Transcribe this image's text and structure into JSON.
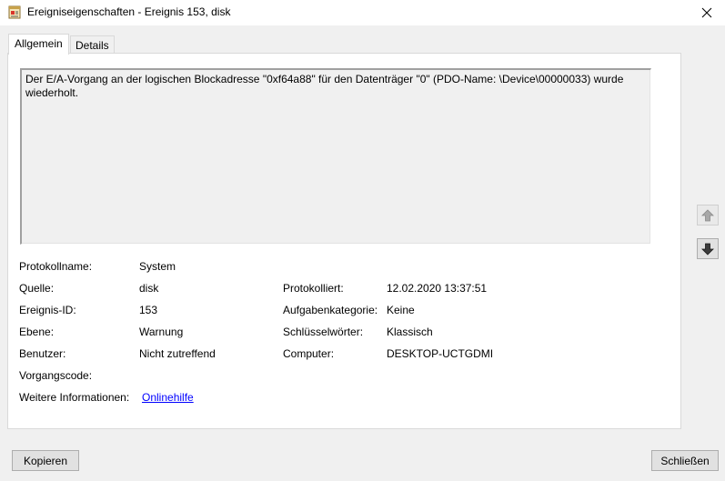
{
  "window": {
    "title": "Ereigniseigenschaften - Ereignis 153, disk"
  },
  "tabs": [
    {
      "label": "Allgemein",
      "active": true
    },
    {
      "label": "Details",
      "active": false
    }
  ],
  "general": {
    "description": "Der E/A-Vorgang an der logischen Blockadresse \"0xf64a88\" für den Datenträger \"0\" (PDO-Name: \\Device\\00000033) wurde wiederholt.",
    "fields": {
      "log_name": {
        "label": "Protokollname:",
        "value": "System"
      },
      "source": {
        "label": "Quelle:",
        "value": "disk"
      },
      "logged": {
        "label": "Protokolliert:",
        "value": "12.02.2020 13:37:51"
      },
      "event_id": {
        "label": "Ereignis-ID:",
        "value": "153"
      },
      "task_category": {
        "label": "Aufgabenkategorie:",
        "value": "Keine"
      },
      "level": {
        "label": "Ebene:",
        "value": "Warnung"
      },
      "keywords": {
        "label": "Schlüsselwörter:",
        "value": "Klassisch"
      },
      "user": {
        "label": "Benutzer:",
        "value": "Nicht zutreffend"
      },
      "computer": {
        "label": "Computer:",
        "value": "DESKTOP-UCTGDMI"
      },
      "opcode": {
        "label": "Vorgangscode:",
        "value": ""
      },
      "more_info": {
        "label": "Weitere Informationen:",
        "value": "Onlinehilfe"
      }
    }
  },
  "buttons": {
    "copy": "Kopieren",
    "close": "Schließen"
  },
  "colors": {
    "link": "#0000ff",
    "panel": "#ffffff",
    "background": "#f0f0f0"
  },
  "icons": {
    "title": "event-viewer-icon",
    "close": "close-icon",
    "previous": "arrow-up-icon",
    "next": "arrow-down-icon"
  }
}
